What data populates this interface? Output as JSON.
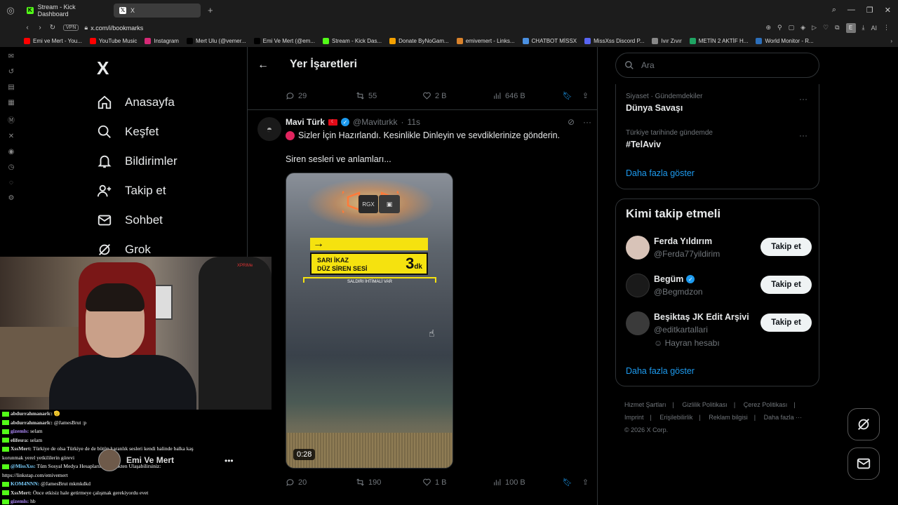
{
  "browser": {
    "tabs": [
      {
        "label": "Stream - Kick Dashboard",
        "icon": "kick-icon",
        "color": "#53fc18"
      },
      {
        "label": "X",
        "icon": "x-icon",
        "color": "#ffffff"
      }
    ],
    "url": "x.com/i/bookmarks",
    "vpn_label": "VPN",
    "ext_label": "E",
    "ai_label": "AI",
    "bookmarks": [
      {
        "label": "Emi ve Mert - You...",
        "color": "#ff0000"
      },
      {
        "label": "YouTube Music",
        "color": "#ff0000"
      },
      {
        "label": "Instagram",
        "color": "#d62976"
      },
      {
        "label": "Mert Ulu (@vemer...",
        "color": "#000000"
      },
      {
        "label": "Emi Ve Mert (@em...",
        "color": "#000000"
      },
      {
        "label": "Stream - Kick Das...",
        "color": "#53fc18"
      },
      {
        "label": "Donate ByNoGam...",
        "color": "#f4a100"
      },
      {
        "label": "emivemert - Links...",
        "color": "#d9822b"
      },
      {
        "label": "CHATBOT MİSSX",
        "color": "#4a90e2"
      },
      {
        "label": "MissXss Discord P...",
        "color": "#5865f2"
      },
      {
        "label": "Ivır Zıvır",
        "color": "#888888"
      },
      {
        "label": "METİN 2 AKTİF H...",
        "color": "#1fa463"
      },
      {
        "label": "World Monitor - R...",
        "color": "#2c6fbb"
      }
    ]
  },
  "nav": {
    "logo": "X",
    "items": [
      {
        "label": "Anasayfa",
        "icon": "home-icon"
      },
      {
        "label": "Keşfet",
        "icon": "search-icon"
      },
      {
        "label": "Bildirimler",
        "icon": "bell-icon"
      },
      {
        "label": "Takip et",
        "icon": "person-plus-icon"
      },
      {
        "label": "Sohbet",
        "icon": "mail-icon"
      },
      {
        "label": "Grok",
        "icon": "grok-icon"
      }
    ]
  },
  "center": {
    "title": "Yer İşaretleri",
    "prev_actions": {
      "replies": "29",
      "reposts": "55",
      "likes": "2 B",
      "views": "646 B"
    },
    "tweet": {
      "name": "Mavi Türk",
      "handle": "@Maviturkk",
      "time": "11s",
      "text1": "Sizler İçin Hazırlandı. Kesinlikle Dinleyin ve sevdiklerinize gönderin.",
      "text2": "Siren sesleri ve anlamları...",
      "media": {
        "rgx_label": "RGX",
        "banner_text": "SARI İKAZ\nDÜZ SİREN SESİ",
        "banner_number": "3",
        "banner_unit": "dk",
        "sub_text": "SALDIRI İHTİMALİ VAR",
        "duration": "0:28"
      },
      "actions": {
        "replies": "20",
        "reposts": "190",
        "likes": "1 B",
        "views": "100 B"
      }
    }
  },
  "right": {
    "search_placeholder": "Ara",
    "trends": [
      {
        "meta": "Siyaset · Gündemdekiler",
        "title": "Dünya Savaşı"
      },
      {
        "meta": "Türkiye tarihinde gündemde",
        "title": "#TelAviv"
      }
    ],
    "trends_more": "Daha fazla göster",
    "who_title": "Kimi takip etmeli",
    "who": [
      {
        "name": "Ferda Yıldırım",
        "handle": "@Ferda77yildirim",
        "avatar_color": "#d8c3b8",
        "verified": false,
        "fan": ""
      },
      {
        "name": "Begüm",
        "handle": "@Begmdzon",
        "avatar_color": "#1a1a1a",
        "verified": true,
        "fan": ""
      },
      {
        "name": "Beşiktaş JK Edit Arşivi",
        "handle": "@editkartallari",
        "avatar_color": "#3a3a3a",
        "verified": false,
        "fan": "Hayran hesabı"
      }
    ],
    "follow_label": "Takip et",
    "who_more": "Daha fazla göster",
    "footer": [
      "Hizmet Şartları",
      "Gizlilik Politikası",
      "Çerez Politikası",
      "Imprint",
      "Erişilebilirlik",
      "Reklam bilgisi",
      "Daha fazla ···",
      "© 2026 X Corp."
    ]
  },
  "stream": {
    "profile_name": "Emi Ve Mert",
    "chair_brand": "XPRIMe",
    "chat": [
      {
        "user": "abdurrahmanarlc:",
        "cls": "",
        "text": "🫡"
      },
      {
        "user": "abdurrahmanarlc:",
        "cls": "",
        "text": "@JamesBrut :p"
      },
      {
        "user": "gizemls:",
        "cls": "p",
        "text": "selam"
      },
      {
        "user": "elifesra:",
        "cls": "",
        "text": "selam"
      },
      {
        "user": "XssMert:",
        "cls": "",
        "text": "Türkiye de olsa Türkiye de de bütün karanlık sesleri kendi halinde balka kaş"
      },
      {
        "user": "",
        "cls": "",
        "text": "korunmak yerel yetkililerin görevi"
      },
      {
        "user": "@MissXss:",
        "cls": "c",
        "text": "Tüm Sosyal Medya Hesaplarımıza Linkten Ulaşabilirsiniz:"
      },
      {
        "user": "",
        "cls": "",
        "text": "https://linkstap.com/emivemert"
      },
      {
        "user": "KOM4NNN:",
        "cls": "c",
        "text": "@JamesBrut mkmkdkd"
      },
      {
        "user": "XssMert:",
        "cls": "",
        "text": "Önce etkisiz hale getirmeye çalışmak gerekiyordu evet"
      },
      {
        "user": "gizemls:",
        "cls": "p",
        "text": "hb"
      }
    ]
  }
}
